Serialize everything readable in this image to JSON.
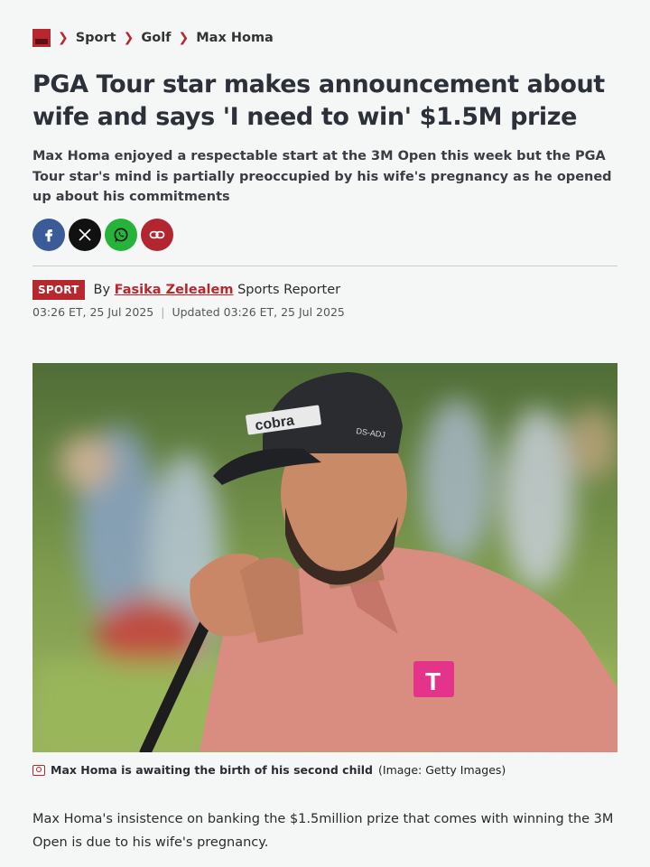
{
  "breadcrumb": {
    "items": [
      "Sport",
      "Golf",
      "Max Homa"
    ]
  },
  "headline": "PGA Tour star makes announcement about wife and says 'I need to win' $1.5M prize",
  "standfirst": "Max Homa enjoyed a respectable start at the 3M Open this week but the PGA Tour star's mind is partially preoccupied by his wife's pregnancy as he opened up about his commitments",
  "share": [
    "facebook-icon",
    "x-icon",
    "whatsapp-icon",
    "link-icon"
  ],
  "byline": {
    "section_tag": "SPORT",
    "by": "By",
    "author": "Fasika Zelealem",
    "role": "Sports Reporter",
    "published": "03:26 ET, 25 Jul 2025",
    "updated": "Updated 03:26 ET, 25 Jul 2025"
  },
  "image": {
    "cap_logo": "cobra",
    "cap_side": "DS-ADJ",
    "shirt_logo": "T",
    "caption_text": "Max Homa is awaiting the birth of his second child",
    "credit": "(Image: Getty Images)"
  },
  "body": "Max Homa's insistence on banking the $1.5million prize that comes with winning the 3M Open is due to his wife's pregnancy.",
  "colors": {
    "brand": "#b8262e",
    "facebook": "#3a5a98",
    "whatsapp": "#25b33a",
    "x": "#111111"
  }
}
